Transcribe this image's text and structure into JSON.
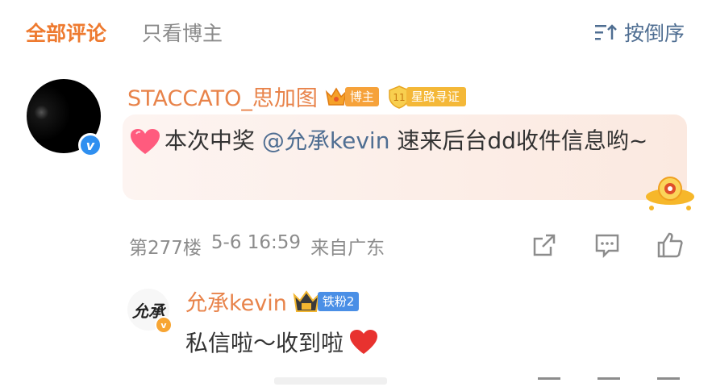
{
  "tabs": [
    {
      "label": "全部评论",
      "active": true
    },
    {
      "label": "只看博主",
      "active": false
    }
  ],
  "sort": {
    "label": "按倒序",
    "icon": "sort-desc-icon"
  },
  "comment": {
    "author": "STACCATO_思加图",
    "role_badge": "博主",
    "star_badge": "星路寻证",
    "star_level": "11",
    "verified_icon": "v",
    "text_prefix": "本次中奖 ",
    "mention": "@允承kevin",
    "text_suffix": " 速来后台dd收件信息哟~",
    "floor": "第277楼",
    "time": "5-6 16:59",
    "location": "来自广东"
  },
  "reply": {
    "author": "允承kevin",
    "fan_badge": "铁粉2",
    "avatar_text": "允承",
    "text": "私信啦～收到啦"
  },
  "colors": {
    "accent": "#ee7a2f",
    "link": "#4f6e92",
    "author": "#e8834a",
    "meta": "#8c8c8c"
  }
}
